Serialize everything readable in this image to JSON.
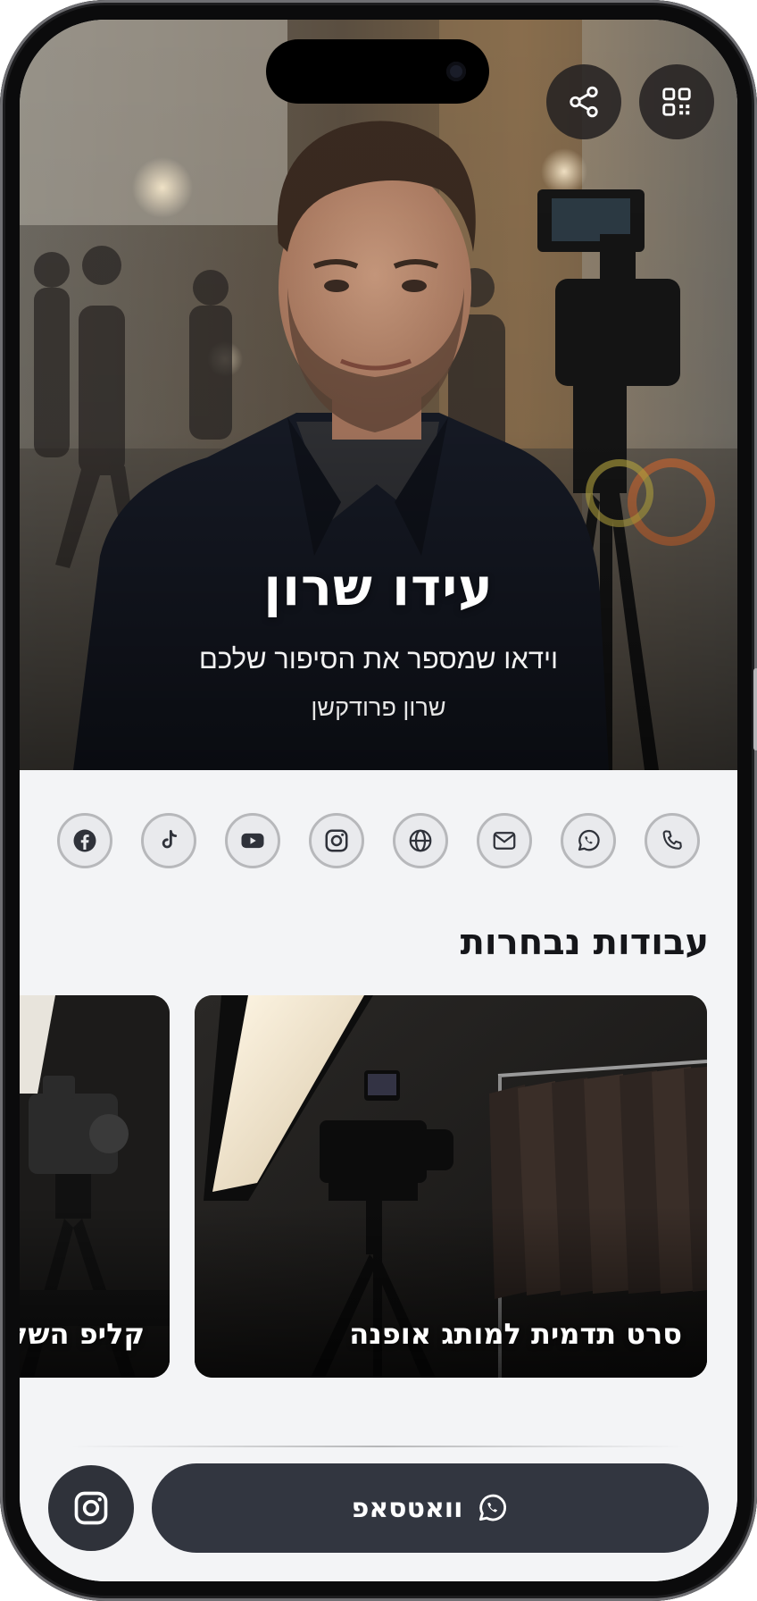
{
  "hero": {
    "name": "עידו שרון",
    "tagline": "וידאו שמספר את הסיפור שלכם",
    "company": "שרון פרודקשן"
  },
  "top_actions": {
    "share_icon": "share-icon",
    "qr_icon": "qr-code-icon"
  },
  "social_links": [
    {
      "name": "facebook",
      "icon": "facebook-icon"
    },
    {
      "name": "tiktok",
      "icon": "tiktok-icon"
    },
    {
      "name": "youtube",
      "icon": "youtube-icon"
    },
    {
      "name": "instagram",
      "icon": "instagram-icon"
    },
    {
      "name": "website",
      "icon": "globe-icon"
    },
    {
      "name": "email",
      "icon": "mail-icon"
    },
    {
      "name": "whatsapp",
      "icon": "whatsapp-icon"
    },
    {
      "name": "phone",
      "icon": "phone-icon"
    }
  ],
  "portfolio": {
    "title": "עבודות נבחרות",
    "items": [
      {
        "title": "סרט תדמית למותג אופנה"
      },
      {
        "title": "קליפ השקה"
      }
    ]
  },
  "bottom_bar": {
    "whatsapp_label": "וואטסאפ",
    "whatsapp_icon": "whatsapp-icon",
    "instagram_icon": "instagram-icon"
  },
  "colors": {
    "button_dark": "#323640",
    "page_bg": "#f3f4f6",
    "text_dark": "#15161a"
  }
}
